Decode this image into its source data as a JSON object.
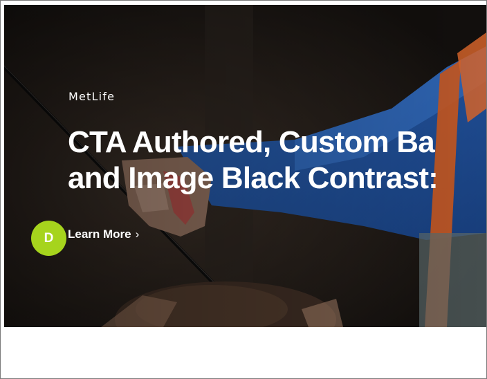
{
  "hero": {
    "eyebrow": "MetLife",
    "headline_line1": "CTA Authored, Custom Ba",
    "headline_line2": "and Image Black Contrast:",
    "cta_label": "Learn More",
    "cta_chevron": "›"
  },
  "avatar": {
    "initial": "D",
    "color": "#a6d41d"
  },
  "colors": {
    "hero_text": "#ffffff",
    "hero_background": "#1b1815",
    "jacket_blue": "#1f4f9c",
    "safety_orange": "#c8571d"
  }
}
